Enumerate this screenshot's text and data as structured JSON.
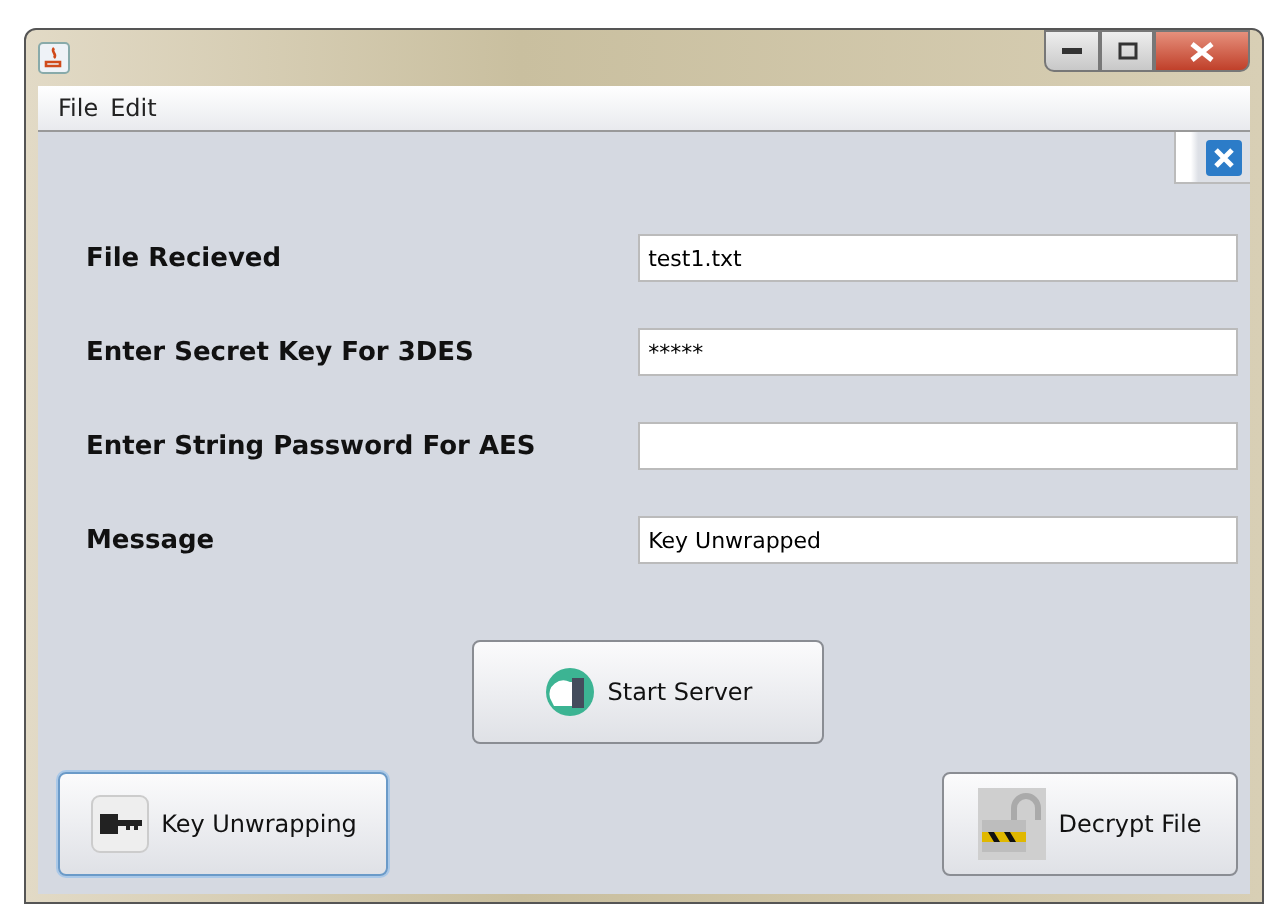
{
  "menu": [
    {
      "label": "File"
    },
    {
      "label": "Edit"
    }
  ],
  "fields": [
    {
      "label": "File Recieved",
      "value": "test1.txt"
    },
    {
      "label": "Enter Secret Key For 3DES",
      "value": "*****"
    },
    {
      "label": "Enter String Password For AES"
    },
    {
      "label": "Message",
      "value": "Key Unwrapped"
    }
  ],
  "buttons": [
    {
      "kind": "server",
      "label": "Start Server",
      "focused": false
    },
    {
      "kind": "key",
      "label": "Key Unwrapping",
      "focused": true
    },
    {
      "kind": "lock",
      "label": "Decrypt File",
      "focused": false
    }
  ]
}
